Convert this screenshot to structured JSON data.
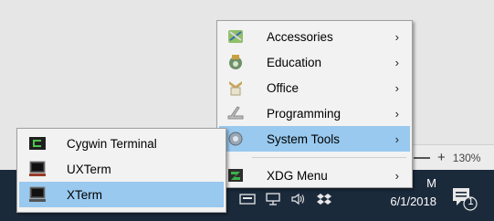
{
  "status": {
    "zoom": "130%"
  },
  "main_menu": {
    "items": [
      {
        "label": "Accessories",
        "icon": "accessories-icon",
        "arrow": "›"
      },
      {
        "label": "Education",
        "icon": "education-icon",
        "arrow": "›"
      },
      {
        "label": "Office",
        "icon": "office-icon",
        "arrow": "›"
      },
      {
        "label": "Programming",
        "icon": "programming-icon",
        "arrow": "›"
      },
      {
        "label": "System Tools",
        "icon": "system-tools-icon",
        "arrow": "›"
      },
      {
        "label": "XDG Menu",
        "icon": "xdg-menu-icon",
        "arrow": "›"
      }
    ]
  },
  "sub_menu": {
    "items": [
      {
        "label": "Cygwin Terminal",
        "icon": "cygwin-terminal-icon"
      },
      {
        "label": "UXTerm",
        "icon": "uxterm-icon"
      },
      {
        "label": "XTerm",
        "icon": "xterm-icon"
      }
    ]
  },
  "clock": {
    "time": "M",
    "date": "6/1/2018"
  },
  "notifications": {
    "count": "1"
  }
}
